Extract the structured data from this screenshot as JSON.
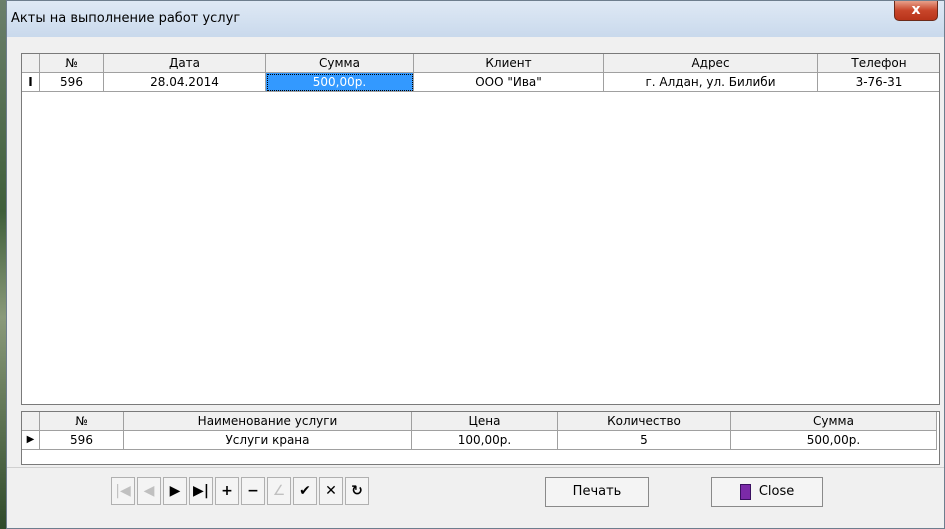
{
  "window": {
    "title": "Акты на выполнение работ услуг",
    "close_glyph": "x"
  },
  "acts": {
    "columns": [
      "№",
      "Дата",
      "Сумма",
      "Клиент",
      "Адрес",
      "Телефон"
    ],
    "rows": [
      {
        "indicator": "I",
        "num": "596",
        "date": "28.04.2014",
        "sum": "500,00р.",
        "client": "ООО \"Ива\"",
        "address": "г. Алдан, ул. Билиби",
        "phone": "3-76-31"
      }
    ]
  },
  "services": {
    "columns": [
      "№",
      "Наименование услуги",
      "Цена",
      "Количество",
      "Сумма"
    ],
    "rows": [
      {
        "indicator": "▶",
        "num": "596",
        "name": "Услуги крана",
        "price": "100,00р.",
        "qty": "5",
        "sum": "500,00р."
      }
    ]
  },
  "navigator": {
    "first": "|◀",
    "prior": "◀",
    "next": "▶",
    "last": "▶|",
    "insert": "+",
    "delete": "−",
    "edit": "∠",
    "post": "✔",
    "cancel": "✕",
    "refresh": "↻"
  },
  "buttons": {
    "print": "Печать",
    "close": "Close"
  },
  "colors": {
    "selection": "#3399ff",
    "close_red": "#c8452a"
  }
}
